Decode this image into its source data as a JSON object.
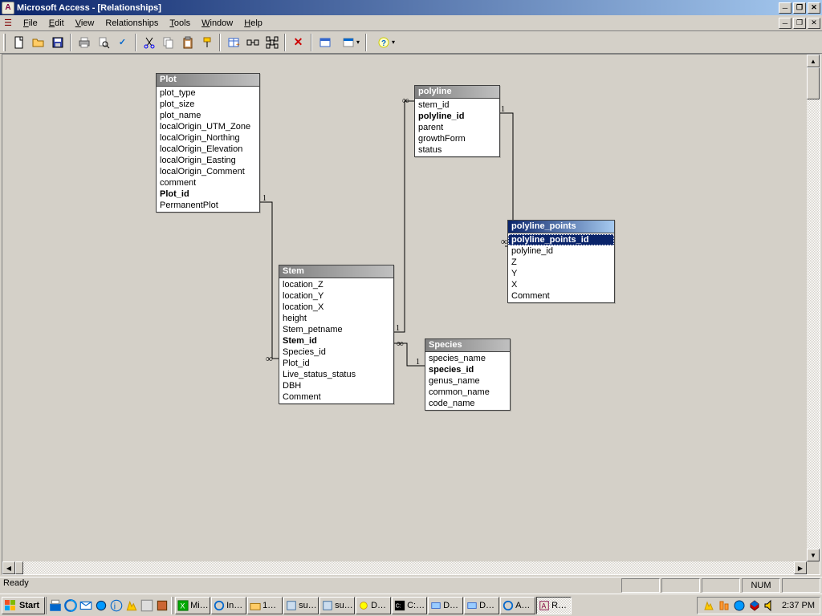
{
  "window": {
    "title": "Microsoft Access - [Relationships]"
  },
  "menu": {
    "file": "File",
    "edit": "Edit",
    "view": "View",
    "relationships": "Relationships",
    "tools": "Tools",
    "window": "Window",
    "help": "Help"
  },
  "tables": {
    "plot": {
      "title": "Plot",
      "fields": {
        "plot_type": "plot_type",
        "plot_size": "plot_size",
        "plot_name": "plot_name",
        "localOrigin_UTM_Zone": "localOrigin_UTM_Zone",
        "localOrigin_Northing": "localOrigin_Northing",
        "localOrigin_Elevation": "localOrigin_Elevation",
        "localOrigin_Easting": "localOrigin_Easting",
        "localOrigin_Comment": "localOrigin_Comment",
        "comment": "comment",
        "Plot_id": "Plot_id",
        "PermanentPlot": "PermanentPlot"
      }
    },
    "polyline": {
      "title": "polyline",
      "fields": {
        "stem_id": "stem_id",
        "polyline_id": "polyline_id",
        "parent": "parent",
        "growthForm": "growthForm",
        "status": "status"
      }
    },
    "polyline_points": {
      "title": "polyline_points",
      "fields": {
        "polyline_points_id": "polyline_points_id",
        "polyline_id": "polyline_id",
        "Z": "Z",
        "Y": "Y",
        "X": "X",
        "Comment": "Comment"
      }
    },
    "stem": {
      "title": "Stem",
      "fields": {
        "location_Z": "location_Z",
        "location_Y": "location_Y",
        "location_X": "location_X",
        "height": "height",
        "Stem_petname": "Stem_petname",
        "Stem_id": "Stem_id",
        "Species_id": "Species_id",
        "Plot_id": "Plot_id",
        "Live_status_status": "Live_status_status",
        "DBH": "DBH",
        "Comment": "Comment"
      }
    },
    "species": {
      "title": "Species",
      "fields": {
        "species_name": "species_name",
        "species_id": "species_id",
        "genus_name": "genus_name",
        "common_name": "common_name",
        "code_name": "code_name"
      }
    }
  },
  "cardinality": {
    "one": "1",
    "many": "∞"
  },
  "status": {
    "ready": "Ready",
    "num": "NUM"
  },
  "taskbar": {
    "start": "Start",
    "tasks": {
      "mi": "Mi…",
      "in": "In…",
      "one": "1…",
      "su1": "su…",
      "su2": "su…",
      "d1": "D…",
      "c": "C:…",
      "d2": "D…",
      "d3": "D…",
      "a": "A…",
      "r": "R…"
    },
    "clock": "2:37 PM"
  }
}
